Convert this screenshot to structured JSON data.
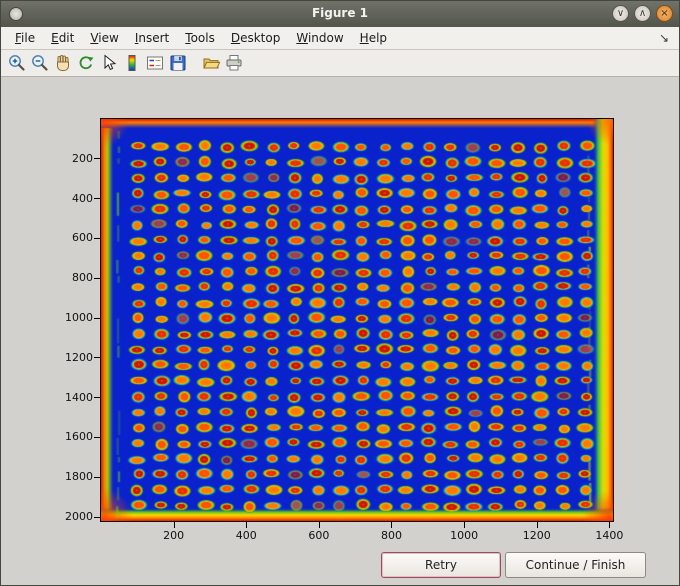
{
  "window": {
    "title": "Figure 1",
    "controls": {
      "minimize_glyph": "∨",
      "maximize_glyph": "∧",
      "close_glyph": "×"
    }
  },
  "menu": {
    "items": [
      "File",
      "Edit",
      "View",
      "Insert",
      "Tools",
      "Desktop",
      "Window",
      "Help"
    ],
    "dock_glyph": "↘"
  },
  "toolbar": {
    "buttons": [
      "zoom-in",
      "zoom-out",
      "pan",
      "rotate-3d",
      "data-cursor",
      "colorbar",
      "insert-legend",
      "save-figure",
      "open-file",
      "print-figure"
    ]
  },
  "buttons": {
    "retry": "Retry",
    "continue_finish": "Continue / Finish"
  },
  "colors": {
    "titlebar_bg": "#5b5d53",
    "content_bg": "#d3d1cd",
    "plot_background": "#0a22cc",
    "retry_border": "#a34a5a"
  },
  "chart_data": {
    "type": "heatmap",
    "title": "",
    "description": "Pseudocolor (jet colormap) scan of a microarray plate: a regular grid of hybridization spots with hot red-orange cores, yellow halos and green-cyan rings on a deep blue background; the plate edges saturate to green, yellow, orange and red, strongest along the right, bottom and corners, with streaky green columns just inside the left and right edges.",
    "xlim": [
      0,
      1410
    ],
    "ylim": [
      0,
      2020
    ],
    "x_ticks": [
      200,
      400,
      600,
      800,
      1000,
      1200,
      1400
    ],
    "y_ticks": [
      200,
      400,
      600,
      800,
      1000,
      1200,
      1400,
      1600,
      1800,
      2000
    ],
    "grid": {
      "cols": 21,
      "rows": 24,
      "x_start": 102,
      "y_start": 140,
      "x_spacing": 61.7,
      "y_spacing": 78.4,
      "spot_rx": 22,
      "spot_ry": 26
    },
    "colors": {
      "background": "#0a22cc",
      "spot_center": "#ff6a00",
      "spot_core": [
        "#c81600",
        "#e62e00",
        "#ff5200",
        "#ff7a00"
      ],
      "spot_mid": "#ffb400",
      "spot_ring": [
        "#8ad800",
        "#50d818",
        "#00c89a",
        "#00b4d8"
      ],
      "edge": [
        "#d81800",
        "#ff7d00",
        "#ffd800",
        "#58c818"
      ]
    }
  }
}
